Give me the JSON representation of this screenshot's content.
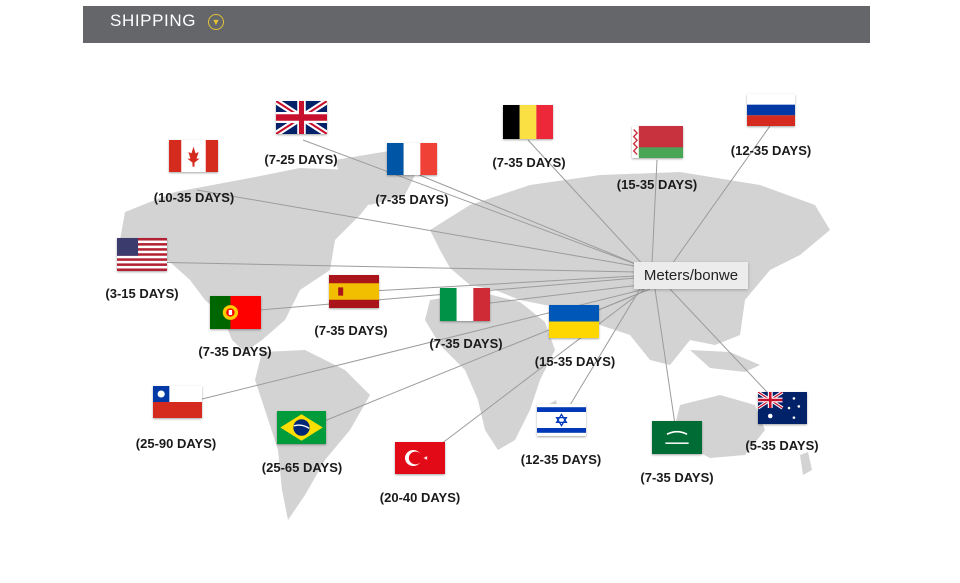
{
  "header": {
    "title": "SHIPPING",
    "toggle_icon": "chevron-down-circle-icon",
    "accent": "#e0c23a",
    "background": "#65666a"
  },
  "hub": {
    "label": "Meters/bonwe"
  },
  "destinations": [
    {
      "country": "united-kingdom",
      "days": "(7-25 DAYS)"
    },
    {
      "country": "canada",
      "days": "(10-35 DAYS)"
    },
    {
      "country": "france",
      "days": "(7-35 DAYS)"
    },
    {
      "country": "belgium",
      "days": "(7-35 DAYS)"
    },
    {
      "country": "belarus",
      "days": "(15-35 DAYS)"
    },
    {
      "country": "russia",
      "days": "(12-35 DAYS)"
    },
    {
      "country": "united-states",
      "days": "(3-15 DAYS)"
    },
    {
      "country": "spain",
      "days": "(7-35 DAYS)"
    },
    {
      "country": "portugal",
      "days": "(7-35 DAYS)"
    },
    {
      "country": "italy",
      "days": "(7-35 DAYS)"
    },
    {
      "country": "ukraine",
      "days": "(15-35 DAYS)"
    },
    {
      "country": "chile",
      "days": "(25-90 DAYS)"
    },
    {
      "country": "brazil",
      "days": "(25-65 DAYS)"
    },
    {
      "country": "turkey",
      "days": "(20-40 DAYS)"
    },
    {
      "country": "israel",
      "days": "(12-35 DAYS)"
    },
    {
      "country": "saudi-arabia",
      "days": "(7-35 DAYS)"
    },
    {
      "country": "australia",
      "days": "(5-35 DAYS)"
    }
  ]
}
